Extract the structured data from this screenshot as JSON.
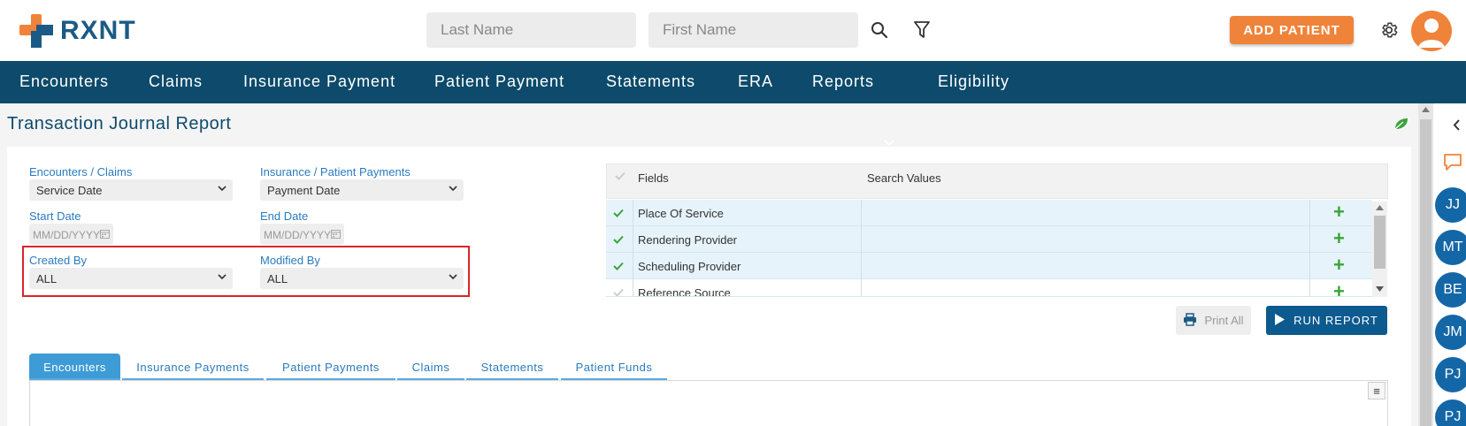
{
  "header": {
    "logo_text": "RXNT",
    "last_name_placeholder": "Last Name",
    "first_name_placeholder": "First Name",
    "add_patient_label": "ADD PATIENT"
  },
  "nav": {
    "items": [
      "Encounters",
      "Claims",
      "Insurance Payment",
      "Patient Payment",
      "Statements",
      "ERA",
      "Reports",
      "Eligibility"
    ]
  },
  "page": {
    "title": "Transaction Journal Report"
  },
  "filters": {
    "encounters_claims_label": "Encounters / Claims",
    "encounters_claims_value": "Service Date",
    "insurance_patient_payments_label": "Insurance / Patient Payments",
    "insurance_patient_payments_value": "Payment Date",
    "start_date_label": "Start Date",
    "start_date_placeholder": "MM/DD/YYYY",
    "end_date_label": "End Date",
    "end_date_placeholder": "MM/DD/YYYY",
    "created_by_label": "Created By",
    "created_by_value": "ALL",
    "modified_by_label": "Modified By",
    "modified_by_value": "ALL"
  },
  "fields_table": {
    "col_fields": "Fields",
    "col_search_values": "Search Values",
    "rows": [
      "Place Of Service",
      "Rendering Provider",
      "Scheduling Provider",
      "Reference Source"
    ]
  },
  "actions": {
    "print_all": "Print All",
    "run_report": "RUN REPORT"
  },
  "tabs": [
    "Encounters",
    "Insurance Payments",
    "Patient Payments",
    "Claims",
    "Statements",
    "Patient Funds"
  ],
  "side_avatars": [
    "JJ",
    "MT",
    "BE",
    "JM",
    "PJ",
    "PJ"
  ],
  "colors": {
    "brand_orange": "#f0833a",
    "brand_navy": "#0d4a6b",
    "link_blue": "#2a7bbf",
    "highlight_red": "#d9252b"
  }
}
